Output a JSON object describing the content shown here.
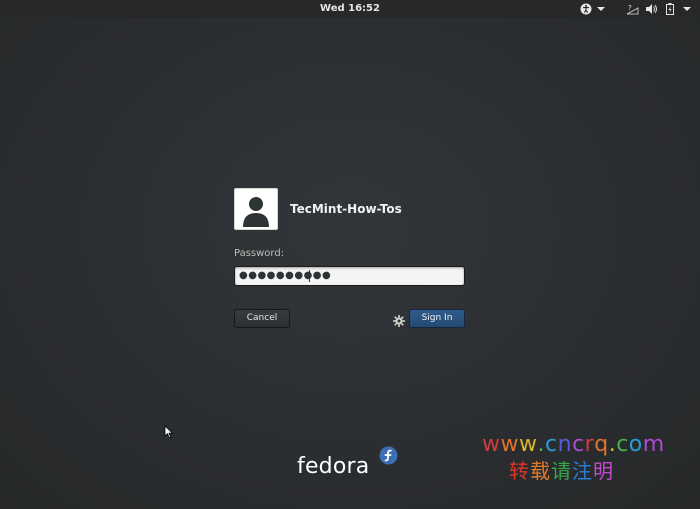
{
  "topbar": {
    "clock": "Wed 16:52",
    "icons": [
      "accessibility-icon",
      "dropdown-arrow-icon",
      "network-icon",
      "volume-icon",
      "battery-icon",
      "system-menu-arrow-icon"
    ]
  },
  "login": {
    "username": "TecMint-How-Tos",
    "avatar_icon": "user-avatar-icon",
    "password_label": "Password:",
    "password_value": "●●●●●●●●●●",
    "cancel_label": "Cancel",
    "signin_label": "Sign In",
    "session_icon": "gear-icon",
    "signin_color": "#2a5685"
  },
  "branding": {
    "logo_text": "fedora",
    "logo_mark_icon": "fedora-infinity-icon",
    "logo_mark_color": "#3c6eb4"
  },
  "watermark": {
    "url": "www.cncrq.com",
    "url_colors": [
      "#d23c3c",
      "#e0732b",
      "#d8b52a",
      "#4caf50",
      "#2a9dd6",
      "#5a5ad6",
      "#b04ad0",
      "#d23c3c",
      "#e0732b",
      "#d8b52a",
      "#4caf50",
      "#2a9dd6",
      "#b04ad0"
    ],
    "caption": "转载请注明",
    "caption_colors": [
      "#e0332b",
      "#e07a2b",
      "#3aa84a",
      "#2a7ed6",
      "#c24ad0"
    ]
  }
}
